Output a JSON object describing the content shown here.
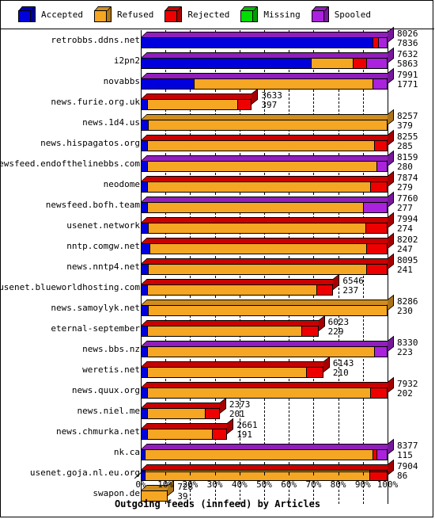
{
  "legend": {
    "items": [
      {
        "label": "Accepted",
        "color": "#0000dd",
        "icon": "cube-icon"
      },
      {
        "label": "Refused",
        "color": "#f5a623",
        "icon": "cube-icon"
      },
      {
        "label": "Rejected",
        "color": "#ee0000",
        "icon": "cube-icon"
      },
      {
        "label": "Missing",
        "color": "#00dd00",
        "icon": "cube-icon"
      },
      {
        "label": "Spooled",
        "color": "#aa22dd",
        "icon": "cube-icon"
      }
    ]
  },
  "chart_data": {
    "type": "bar",
    "orientation": "horizontal",
    "stacked": true,
    "title": "Outgoing feeds (innfeed) by Articles",
    "xlabel": "Outgoing feeds (innfeed) by Articles",
    "ylabel": "",
    "xlim": [
      0,
      100
    ],
    "xunit": "%",
    "grid": true,
    "legend_position": "top",
    "tick_labels": [
      "0%",
      "10%",
      "20%",
      "30%",
      "40%",
      "50%",
      "60%",
      "70%",
      "80%",
      "90%",
      "100%"
    ],
    "tick_values": [
      0,
      10,
      20,
      30,
      40,
      50,
      60,
      70,
      80,
      90,
      100
    ],
    "series_names": [
      "Accepted",
      "Refused",
      "Rejected",
      "Missing",
      "Spooled"
    ],
    "series_colors": [
      "#0000dd",
      "#f5a623",
      "#ee0000",
      "#00dd00",
      "#aa22dd"
    ],
    "categories": [
      "retrobbs.ddns.net",
      "i2pn2",
      "novabbs",
      "news.furie.org.uk",
      "news.1d4.us",
      "news.hispagatos.org",
      "newsfeed.endofthelinebbs.com",
      "neodome",
      "newsfeed.bofh.team",
      "usenet.network",
      "nntp.comgw.net",
      "news.nntp4.net",
      "usenet.blueworldhosting.com",
      "news.samoylyk.net",
      "eternal-september",
      "news.bbs.nz",
      "weretis.net",
      "news.quux.org",
      "news.niel.me",
      "news.chmurka.net",
      "nk.ca",
      "usenet.goja.nl.eu.org",
      "swapon.de"
    ],
    "rows": [
      {
        "label": "retrobbs.ddns.net",
        "total": 8026,
        "offered": 7836,
        "bar_pct": 100,
        "segments": [
          {
            "name": "Accepted",
            "pct": 94.0
          },
          {
            "name": "Rejected",
            "pct": 2.0
          },
          {
            "name": "Spooled",
            "pct": 4.0
          }
        ]
      },
      {
        "label": "i2pn2",
        "total": 7632,
        "offered": 5863,
        "bar_pct": 100,
        "segments": [
          {
            "name": "Accepted",
            "pct": 69.0
          },
          {
            "name": "Refused",
            "pct": 17.0
          },
          {
            "name": "Rejected",
            "pct": 5.5
          },
          {
            "name": "Spooled",
            "pct": 8.5
          }
        ]
      },
      {
        "label": "novabbs",
        "total": 7991,
        "offered": 1771,
        "bar_pct": 100,
        "segments": [
          {
            "name": "Accepted",
            "pct": 21.5
          },
          {
            "name": "Refused",
            "pct": 72.5
          },
          {
            "name": "Spooled",
            "pct": 6.0
          }
        ]
      },
      {
        "label": "news.furie.org.uk",
        "total": 3633,
        "offered": 397,
        "bar_pct": 45.0,
        "segments": [
          {
            "name": "Accepted",
            "pct": 2.5
          },
          {
            "name": "Refused",
            "pct": 36.5
          },
          {
            "name": "Rejected",
            "pct": 6.0
          }
        ]
      },
      {
        "label": "news.1d4.us",
        "total": 8257,
        "offered": 379,
        "bar_pct": 100,
        "segments": [
          {
            "name": "Accepted",
            "pct": 3.0
          },
          {
            "name": "Refused",
            "pct": 97.0
          }
        ]
      },
      {
        "label": "news.hispagatos.org",
        "total": 8255,
        "offered": 285,
        "bar_pct": 100,
        "segments": [
          {
            "name": "Accepted",
            "pct": 2.5
          },
          {
            "name": "Refused",
            "pct": 92.0
          },
          {
            "name": "Rejected",
            "pct": 5.5
          }
        ]
      },
      {
        "label": "newsfeed.endofthelinebbs.com",
        "total": 8159,
        "offered": 280,
        "bar_pct": 100,
        "segments": [
          {
            "name": "Accepted",
            "pct": 2.5
          },
          {
            "name": "Refused",
            "pct": 93.0
          },
          {
            "name": "Spooled",
            "pct": 4.5
          }
        ]
      },
      {
        "label": "neodome",
        "total": 7874,
        "offered": 279,
        "bar_pct": 100,
        "segments": [
          {
            "name": "Accepted",
            "pct": 2.5
          },
          {
            "name": "Refused",
            "pct": 90.5
          },
          {
            "name": "Rejected",
            "pct": 7.0
          }
        ]
      },
      {
        "label": "newsfeed.bofh.team",
        "total": 7760,
        "offered": 277,
        "bar_pct": 100,
        "segments": [
          {
            "name": "Accepted",
            "pct": 2.5
          },
          {
            "name": "Refused",
            "pct": 87.5
          },
          {
            "name": "Spooled",
            "pct": 10.0
          }
        ]
      },
      {
        "label": "usenet.network",
        "total": 7994,
        "offered": 274,
        "bar_pct": 100,
        "segments": [
          {
            "name": "Accepted",
            "pct": 3.0
          },
          {
            "name": "Refused",
            "pct": 88.0
          },
          {
            "name": "Rejected",
            "pct": 9.0
          }
        ]
      },
      {
        "label": "nntp.comgw.net",
        "total": 8202,
        "offered": 247,
        "bar_pct": 100,
        "segments": [
          {
            "name": "Accepted",
            "pct": 3.5
          },
          {
            "name": "Refused",
            "pct": 88.0
          },
          {
            "name": "Rejected",
            "pct": 8.5
          }
        ]
      },
      {
        "label": "news.nntp4.net",
        "total": 8095,
        "offered": 241,
        "bar_pct": 100,
        "segments": [
          {
            "name": "Accepted",
            "pct": 3.0
          },
          {
            "name": "Refused",
            "pct": 88.5
          },
          {
            "name": "Rejected",
            "pct": 8.5
          }
        ]
      },
      {
        "label": "usenet.blueworldhosting.com",
        "total": 6546,
        "offered": 237,
        "bar_pct": 78.0,
        "segments": [
          {
            "name": "Accepted",
            "pct": 2.5
          },
          {
            "name": "Refused",
            "pct": 68.5
          },
          {
            "name": "Rejected",
            "pct": 7.0
          }
        ]
      },
      {
        "label": "news.samoylyk.net",
        "total": 8286,
        "offered": 230,
        "bar_pct": 100,
        "segments": [
          {
            "name": "Accepted",
            "pct": 3.0
          },
          {
            "name": "Refused",
            "pct": 97.0
          }
        ]
      },
      {
        "label": "eternal-september",
        "total": 6023,
        "offered": 229,
        "bar_pct": 72.0,
        "segments": [
          {
            "name": "Accepted",
            "pct": 2.5
          },
          {
            "name": "Refused",
            "pct": 62.5
          },
          {
            "name": "Rejected",
            "pct": 7.0
          }
        ]
      },
      {
        "label": "news.bbs.nz",
        "total": 8330,
        "offered": 223,
        "bar_pct": 100,
        "segments": [
          {
            "name": "Accepted",
            "pct": 2.5
          },
          {
            "name": "Refused",
            "pct": 92.0
          },
          {
            "name": "Spooled",
            "pct": 5.5
          }
        ]
      },
      {
        "label": "weretis.net",
        "total": 6143,
        "offered": 210,
        "bar_pct": 74.0,
        "segments": [
          {
            "name": "Accepted",
            "pct": 2.5
          },
          {
            "name": "Refused",
            "pct": 64.5
          },
          {
            "name": "Rejected",
            "pct": 7.0
          }
        ]
      },
      {
        "label": "news.quux.org",
        "total": 7932,
        "offered": 202,
        "bar_pct": 100,
        "segments": [
          {
            "name": "Accepted",
            "pct": 2.5
          },
          {
            "name": "Refused",
            "pct": 90.5
          },
          {
            "name": "Rejected",
            "pct": 7.0
          }
        ]
      },
      {
        "label": "news.niel.me",
        "total": 2373,
        "offered": 201,
        "bar_pct": 32.0,
        "segments": [
          {
            "name": "Accepted",
            "pct": 2.5
          },
          {
            "name": "Refused",
            "pct": 23.5
          },
          {
            "name": "Rejected",
            "pct": 6.0
          }
        ]
      },
      {
        "label": "news.chmurka.net",
        "total": 2661,
        "offered": 191,
        "bar_pct": 35.0,
        "segments": [
          {
            "name": "Accepted",
            "pct": 2.5
          },
          {
            "name": "Refused",
            "pct": 26.5
          },
          {
            "name": "Rejected",
            "pct": 6.0
          }
        ]
      },
      {
        "label": "nk.ca",
        "total": 8377,
        "offered": 115,
        "bar_pct": 100,
        "segments": [
          {
            "name": "Accepted",
            "pct": 1.5
          },
          {
            "name": "Refused",
            "pct": 92.5
          },
          {
            "name": "Rejected",
            "pct": 1.5
          },
          {
            "name": "Spooled",
            "pct": 4.5
          }
        ]
      },
      {
        "label": "usenet.goja.nl.eu.org",
        "total": 7904,
        "offered": 86,
        "bar_pct": 100,
        "segments": [
          {
            "name": "Accepted",
            "pct": 1.5
          },
          {
            "name": "Refused",
            "pct": 91.0
          },
          {
            "name": "Rejected",
            "pct": 7.5
          }
        ]
      },
      {
        "label": "swapon.de",
        "total": 728,
        "offered": 39,
        "bar_pct": 11.0,
        "segments": [
          {
            "name": "Refused",
            "pct": 11.0
          }
        ]
      }
    ]
  }
}
